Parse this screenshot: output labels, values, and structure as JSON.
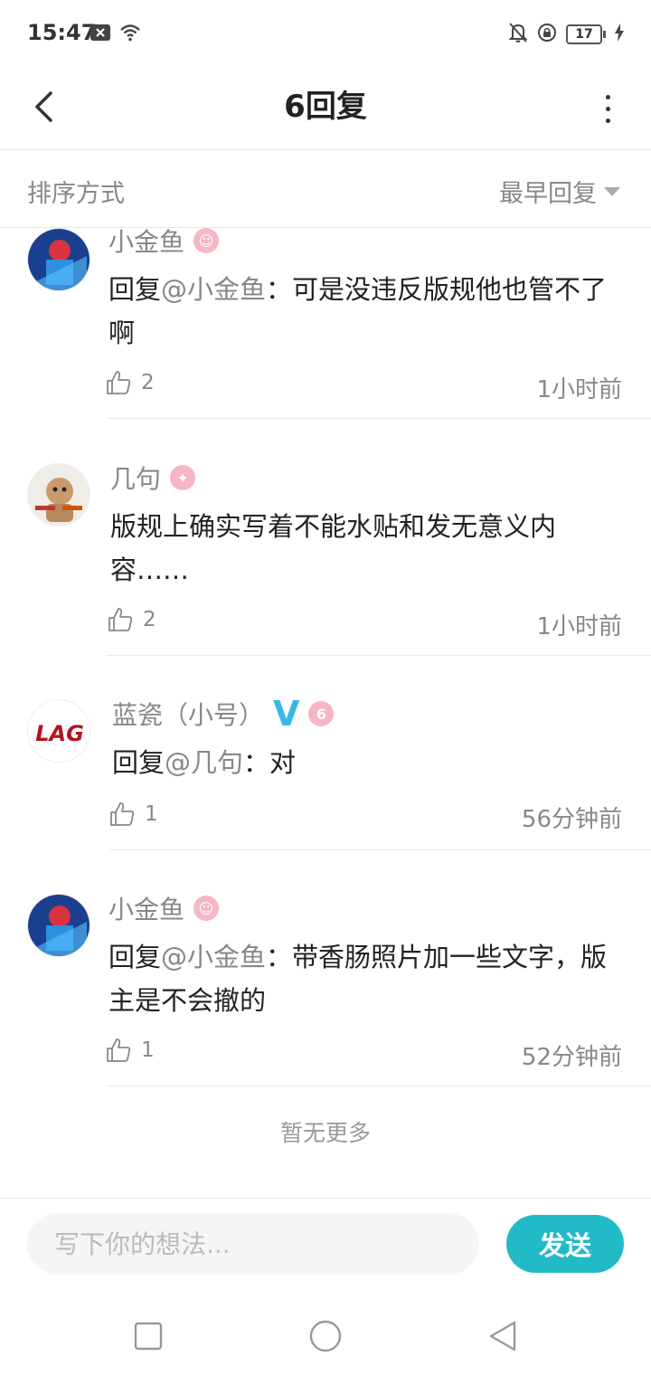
{
  "status_bar": {
    "time": "15:47",
    "battery_level": "17",
    "icons": [
      "notification-x-icon",
      "wifi-icon",
      "mute-bell-icon",
      "lock-rotation-icon",
      "battery-icon",
      "charging-icon"
    ]
  },
  "header": {
    "title": "6回复",
    "back_icon": "back-arrow-icon",
    "more_icon": "more-vertical-icon"
  },
  "sort_bar": {
    "label": "排序方式",
    "value": "最早回复"
  },
  "replies": [
    {
      "name": "小金鱼",
      "badge": "level-badge",
      "prefix": "回复",
      "mention": "@小金鱼",
      "text": "：可是没违反版规他也管不了啊",
      "likes": "2",
      "time": "1小时前"
    },
    {
      "name": "几句",
      "badge": "level-badge",
      "prefix": "",
      "mention": "",
      "text": "版规上确实写着不能水贴和发无意义内容……",
      "likes": "2",
      "time": "1小时前"
    },
    {
      "name": "蓝瓷（小号）",
      "badge": "level-badge",
      "verified": "V",
      "prefix": "回复",
      "mention": "@几句",
      "text": "：对",
      "likes": "1",
      "time": "56分钟前"
    },
    {
      "name": "小金鱼",
      "badge": "level-badge",
      "prefix": "回复",
      "mention": "@小金鱼",
      "text": "：带香肠照片加一些文字，版主是不会撤的",
      "likes": "1",
      "time": "52分钟前"
    }
  ],
  "footer_note": "暂无更多",
  "input_bar": {
    "placeholder": "写下你的想法...",
    "send_label": "发送"
  },
  "nav_bar": {
    "icons": [
      "recent-apps-icon",
      "home-icon",
      "back-icon"
    ]
  },
  "colors": {
    "accent": "#22bac7",
    "level_badge": "#f6b6c6",
    "verified": "#36b9e4",
    "muted_text": "#888888"
  }
}
